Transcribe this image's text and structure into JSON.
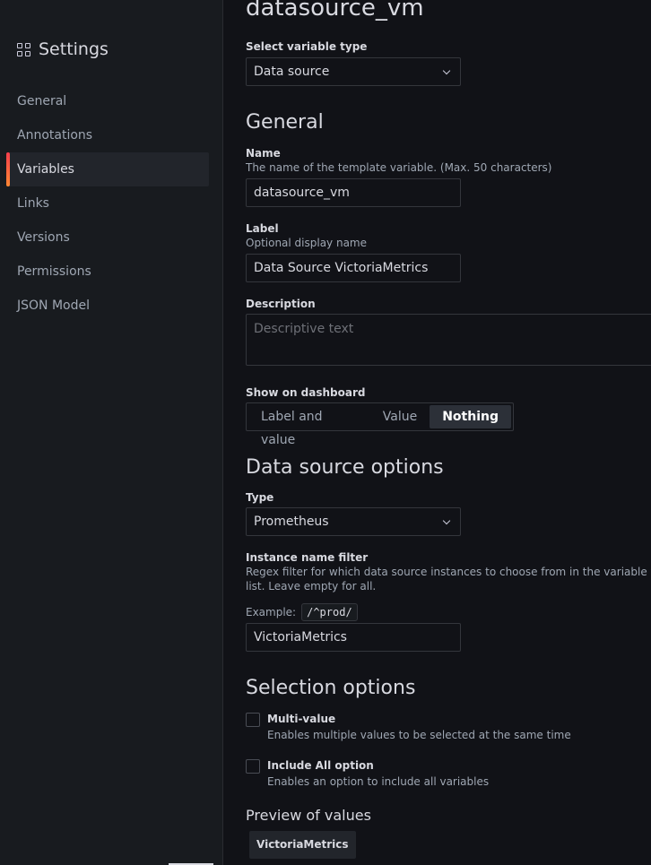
{
  "sidebar": {
    "title": "Settings",
    "items": [
      {
        "label": "General"
      },
      {
        "label": "Annotations"
      },
      {
        "label": "Variables"
      },
      {
        "label": "Links"
      },
      {
        "label": "Versions"
      },
      {
        "label": "Permissions"
      },
      {
        "label": "JSON Model"
      }
    ],
    "active": "Variables"
  },
  "page": {
    "title": "datasource_vm",
    "variable_type_label": "Select variable type",
    "variable_type_value": "Data source"
  },
  "general": {
    "heading": "General",
    "name_label": "Name",
    "name_desc": "The name of the template variable. (Max. 50 characters)",
    "name_value": "datasource_vm",
    "label_label": "Label",
    "label_desc": "Optional display name",
    "label_value": "Data Source VictoriaMetrics",
    "description_label": "Description",
    "description_placeholder": "Descriptive text",
    "show_label": "Show on dashboard",
    "show_options": [
      "Label and value",
      "Value",
      "Nothing"
    ],
    "show_selected": "Nothing"
  },
  "ds_options": {
    "heading": "Data source options",
    "type_label": "Type",
    "type_value": "Prometheus",
    "filter_label": "Instance name filter",
    "filter_desc_1": "Regex filter for which data source instances to choose from in the variable value",
    "filter_desc_2": "list. Leave empty for all.",
    "example_label": "Example:",
    "example_code": "/^prod/",
    "filter_value": "VictoriaMetrics"
  },
  "selection": {
    "heading": "Selection options",
    "multi_label": "Multi-value",
    "multi_desc": "Enables multiple values to be selected at the same time",
    "include_all_label": "Include All option",
    "include_all_desc": "Enables an option to include all variables"
  },
  "preview": {
    "heading": "Preview of values",
    "values": [
      "VictoriaMetrics"
    ]
  },
  "colors": {
    "background": "#111217",
    "sidebar": "#181b1f",
    "accent": "#f55f3e"
  }
}
